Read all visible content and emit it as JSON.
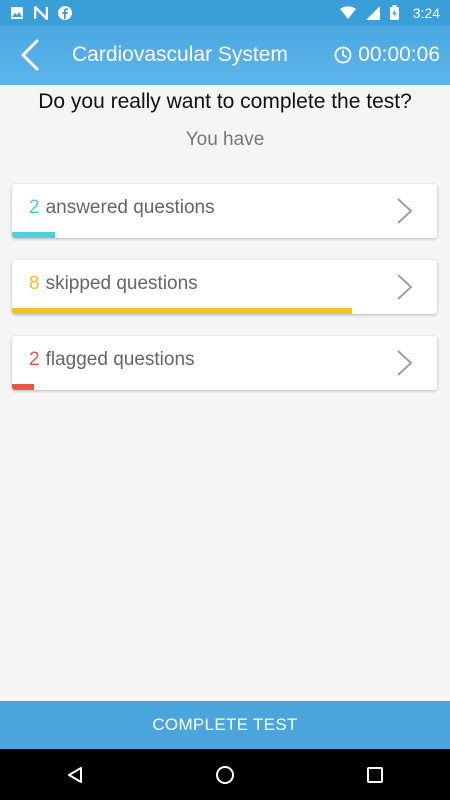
{
  "status_bar": {
    "time": "3:24",
    "left_icons": [
      "image-icon",
      "n-notification-icon",
      "facebook-icon"
    ],
    "right_icons": [
      "wifi-icon",
      "signal-icon",
      "battery-icon"
    ]
  },
  "app_bar": {
    "title": "Cardiovascular System",
    "timer": "00:00:06",
    "back_icon": "chevron-left-icon",
    "timer_icon": "clock-icon"
  },
  "main": {
    "question": "Do you really want to complete the test?",
    "subtitle": "You have"
  },
  "cards": [
    {
      "count": "2",
      "label": "answered questions",
      "color": "#4fd0d8",
      "fraction": 0.1
    },
    {
      "count": "8",
      "label": "skipped questions",
      "color": "#f5c02e",
      "fraction": 0.8
    },
    {
      "count": "2",
      "label": "flagged questions",
      "color": "#e8584a",
      "fraction": 0.05
    }
  ],
  "footer": {
    "complete_label": "COMPLETE TEST"
  },
  "colors": {
    "primary": "#4ba5dd",
    "background": "#f5f5f5"
  },
  "nav_bar": {
    "icons": [
      "back-triangle-icon",
      "home-circle-icon",
      "recents-square-icon"
    ]
  }
}
